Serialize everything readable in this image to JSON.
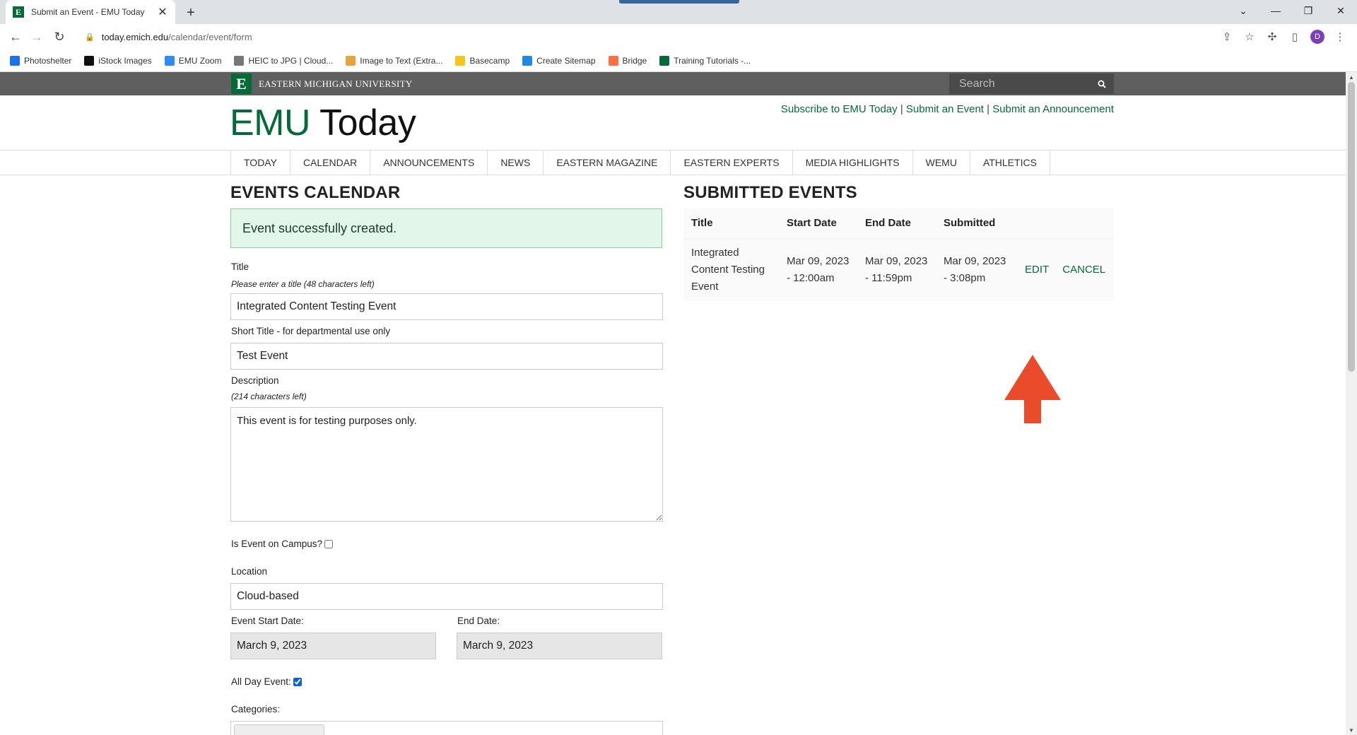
{
  "browser": {
    "tab_title": "Submit an Event - EMU Today",
    "favicon_letter": "E",
    "url_host": "today.emich.edu",
    "url_path": "/calendar/event/form",
    "avatar_letter": "D",
    "bookmarks": [
      {
        "label": "Photoshelter",
        "icon": "photoshelter-icon",
        "color": "#1a73e8"
      },
      {
        "label": "iStock Images",
        "icon": "istock-icon",
        "color": "#111111"
      },
      {
        "label": "EMU Zoom",
        "icon": "zoom-icon",
        "color": "#2d8cff"
      },
      {
        "label": "HEIC to JPG | Cloud...",
        "icon": "cloud-icon",
        "color": "#777777"
      },
      {
        "label": "Image to Text (Extra...",
        "icon": "image-text-icon",
        "color": "#e8a33d"
      },
      {
        "label": "Basecamp",
        "icon": "basecamp-icon",
        "color": "#f5c518"
      },
      {
        "label": "Create Sitemap",
        "icon": "globe-icon",
        "color": "#1e88e5"
      },
      {
        "label": "Bridge",
        "icon": "bridge-icon",
        "color": "#ff7043"
      },
      {
        "label": "Training Tutorials -...",
        "icon": "emu-icon",
        "color": "#046a38"
      }
    ]
  },
  "site": {
    "university_name": "EASTERN MICHIGAN UNIVERSITY",
    "logo_letter": "E",
    "search_placeholder": "Search",
    "title_emu": "EMU",
    "title_today": "Today",
    "toplinks": {
      "subscribe": "Subscribe to EMU Today",
      "submit_event": "Submit an Event",
      "submit_announcement": "Submit an Announcement",
      "separator": "|"
    },
    "nav": [
      "TODAY",
      "CALENDAR",
      "ANNOUNCEMENTS",
      "NEWS",
      "EASTERN MAGAZINE",
      "EASTERN EXPERTS",
      "MEDIA HIGHLIGHTS",
      "WEMU",
      "ATHLETICS"
    ],
    "brand_color": "#046a38"
  },
  "form": {
    "heading": "EVENTS CALENDAR",
    "success_message": "Event successfully created.",
    "title_label": "Title",
    "title_hint": "Please enter a title (48 characters left)",
    "title_value": "Integrated Content Testing Event",
    "short_title_label": "Short Title - for departmental use only",
    "short_title_value": "Test Event",
    "description_label": "Description",
    "description_hint": "(214 characters left)",
    "description_value": "This event is for testing purposes only.",
    "on_campus_label": "Is Event on Campus?",
    "on_campus_checked": false,
    "location_label": "Location",
    "location_value": "Cloud-based",
    "start_date_label": "Event Start Date:",
    "start_date_value": "March 9, 2023",
    "end_date_label": "End Date:",
    "end_date_value": "March 9, 2023",
    "all_day_label": "All Day Event:",
    "all_day_checked": true,
    "categories_label": "Categories:"
  },
  "submitted": {
    "heading": "SUBMITTED EVENTS",
    "columns": [
      "Title",
      "Start Date",
      "End Date",
      "Submitted"
    ],
    "rows": [
      {
        "title": "Integrated Content Testing Event",
        "start": "Mar 09, 2023 - 12:00am",
        "end": "Mar 09, 2023 - 11:59pm",
        "submitted": "Mar 09, 2023 - 3:08pm",
        "edit": "EDIT",
        "cancel": "CANCEL"
      }
    ]
  },
  "annotation": {
    "arrow_color": "#ea4b2a",
    "arrow_target": "edit-link"
  }
}
